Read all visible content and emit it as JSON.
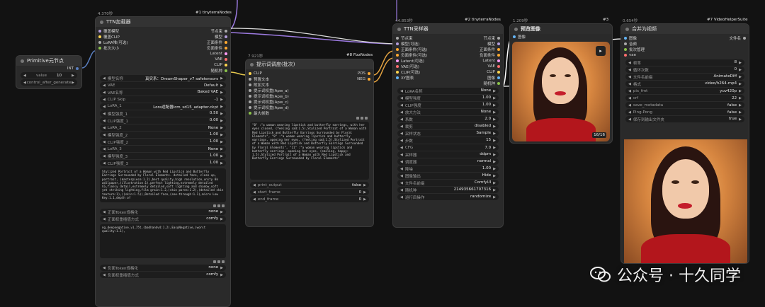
{
  "primitive": {
    "title": "Primitive元节点",
    "output": "INT",
    "widgets": [
      {
        "label": "value",
        "value": "10"
      },
      {
        "label": "control_after_generate",
        "value": "..."
      }
    ]
  },
  "loader": {
    "timing": "4.370秒",
    "badge": "#1 tinyterraNodes",
    "title": "TTN加载器",
    "inputs": [
      "覆盖模型",
      "覆盖CLIP",
      "LoRA堆(可选)",
      "批次大小"
    ],
    "outputs": [
      "节点束",
      "模型",
      "正面条件",
      "负面条件",
      "Latent",
      "VAE",
      "CLIP",
      "随机种"
    ],
    "widgets": [
      {
        "label": "模型名称",
        "value": "真实系：DreamShaper_v7 safetensors"
      },
      {
        "label": "VAE",
        "value": "Default"
      },
      {
        "label": "VAE名称",
        "value": "Baked VAE"
      },
      {
        "label": "CLIP Skip",
        "value": "-1"
      },
      {
        "label": "LoRA_1",
        "value": "Lora适配器lcm_sd15_adapter.ckpt"
      },
      {
        "label": "模型强度_1",
        "value": "0.50"
      },
      {
        "label": "CLIP强度_1",
        "value": "0.00"
      },
      {
        "label": "LoRA_2",
        "value": "None"
      },
      {
        "label": "模型强度_2",
        "value": "1.00"
      },
      {
        "label": "CLIP强度_2",
        "value": "1.00"
      },
      {
        "label": "LoRA_3",
        "value": "None"
      },
      {
        "label": "模型强度_3",
        "value": "1.00"
      },
      {
        "label": "CLIP强度_3",
        "value": "1.00"
      }
    ],
    "positive_text": "Stylized Portrait of a Woman with Red Lipstick and Butterfly Earrings Surrounded by Floral Elements. detailed face, close-up, portrait, (masterpiece:1.2),best quality,high resolution,unity 8k wallpaper,(illustration:1),perfect lighting,extremely detailed CG,finely detail,extremely detailed,soft lighting and shadow,soft yet striking lighting,film grain:1.2,(skin pores:1.2),(detailed skin texture:1),((skin:1.5)),Detailed face,(see-through:1.1),micro Low Key:1.1,depth of",
    "pos_widgets": [
      {
        "label": "正面Token规格化",
        "value": "none"
      },
      {
        "label": "正面权重插值方式",
        "value": "comfy"
      }
    ],
    "negative_text": "ng_deepnegative_v1_75t,(badhandv4:1.2),EasyNegative,(worst quality:1.1),",
    "neg_widgets": [
      {
        "label": "负面Token规格化",
        "value": "none"
      },
      {
        "label": "负面权重插值方式",
        "value": "comfy"
      }
    ]
  },
  "prompt": {
    "timing": "7.921秒",
    "badge": "#8 FizzNodes",
    "title": "提示词调度(批次)",
    "inputs": [
      "CLIP",
      "预置文本",
      "附加文本",
      "提示词权重(Apw_a)",
      "提示词权重(Apw_b)",
      "提示词权重(Apw_c)",
      "提示词权重(Apw_d)",
      "最大帧数"
    ],
    "outputs": [
      "POS",
      "NEG"
    ],
    "text": "\"0\" :\"a woman wearing lipstick and butterfly earrings, with her eyes closed, (feeling sad:1.5),Stylized Portrait of a Woman with Red Lipstick and Butterfly Earrings Surrounded by Floral Elements\", \"8\" :\"a woman wearing lipstick and butterfly earrings, opening her eyes, (feeling sad:1.5),Stylized Portrait of a Woman with Red Lipstick and Butterfly Earrings Surrounded by Floral Elements\", \"11\" :\"a woman wearing lipstick and butterfly earrings, opening her eyes, (smiling, happy: 1.5),Stylized Portrait of a Woman with Red Lipstick and Butterfly Earrings Surrounded by Floral Elements\"",
    "widgets": [
      {
        "label": "print_output",
        "value": "false"
      },
      {
        "label": "start_frame",
        "value": "0"
      },
      {
        "label": "end_frame",
        "value": "0"
      }
    ]
  },
  "sampler": {
    "timing": "44.853秒",
    "badge": "#2 tinyterraNodes",
    "title": "TTN采样器",
    "inputs": [
      "节点束",
      "模型(可选)",
      "正面条件(可选)",
      "负面条件(可选)",
      "Latent(可选)",
      "VAE(可选)",
      "CLIP(可选)",
      "XY图表"
    ],
    "outputs": [
      "节点束",
      "模型",
      "正面条件",
      "负面条件",
      "Latent",
      "VAE",
      "CLIP",
      "图像",
      "随机种"
    ],
    "widgets": [
      {
        "label": "LoRA名称",
        "value": "None"
      },
      {
        "label": "模型强度",
        "value": "1.00"
      },
      {
        "label": "CLIP强度",
        "value": "1.00"
      },
      {
        "label": "放大方法",
        "value": "None"
      },
      {
        "label": "系数",
        "value": "2.0"
      },
      {
        "label": "裁剪",
        "value": "disabled"
      },
      {
        "label": "采样状态",
        "value": "Sample"
      },
      {
        "label": "步数",
        "value": "15"
      },
      {
        "label": "CFG",
        "value": "7.0"
      },
      {
        "label": "采样器",
        "value": "ddpm"
      },
      {
        "label": "调度器",
        "value": "normal"
      },
      {
        "label": "降噪",
        "value": "1.00"
      },
      {
        "label": "图像输出",
        "value": "Hide"
      },
      {
        "label": "文件名前缀",
        "value": "ComfyUI"
      },
      {
        "label": "随机种",
        "value": "214935661707316"
      },
      {
        "label": "运行后操作",
        "value": "randomize"
      }
    ]
  },
  "preview": {
    "timing": "1.209秒",
    "badge": "#3",
    "title": "预览图像",
    "input": "图像",
    "counter": "16/16"
  },
  "combine": {
    "timing": "0.654秒",
    "badge": "#7 VideoHelperSuite",
    "title": "合并为视频",
    "inputs": [
      "图像",
      "音频",
      "批次管理",
      "vae"
    ],
    "output": "文件名",
    "widgets": [
      {
        "label": "帧率",
        "value": "8"
      },
      {
        "label": "循环次数",
        "value": "0"
      },
      {
        "label": "文件名前缀",
        "value": "AnimateDiff"
      },
      {
        "label": "格式",
        "value": "video/h264-mp4"
      },
      {
        "label": "pix_fmt",
        "value": "yuv420p"
      },
      {
        "label": "crf",
        "value": "22"
      },
      {
        "label": "save_metadata",
        "value": "false"
      },
      {
        "label": "Ping-Pong",
        "value": "false"
      },
      {
        "label": "保存到输出文件夹",
        "value": "true"
      }
    ]
  },
  "watermark": {
    "text": "公众号 · 十久同学"
  },
  "colors": {
    "model": "#b39ddb",
    "clip": "#ffd54f",
    "cond": "#ffa931",
    "latent": "#ff9cf9",
    "vae": "#ff6e6e",
    "image": "#64b5f6",
    "int": "#8bc34a",
    "bundle": "#aaaaaa"
  }
}
